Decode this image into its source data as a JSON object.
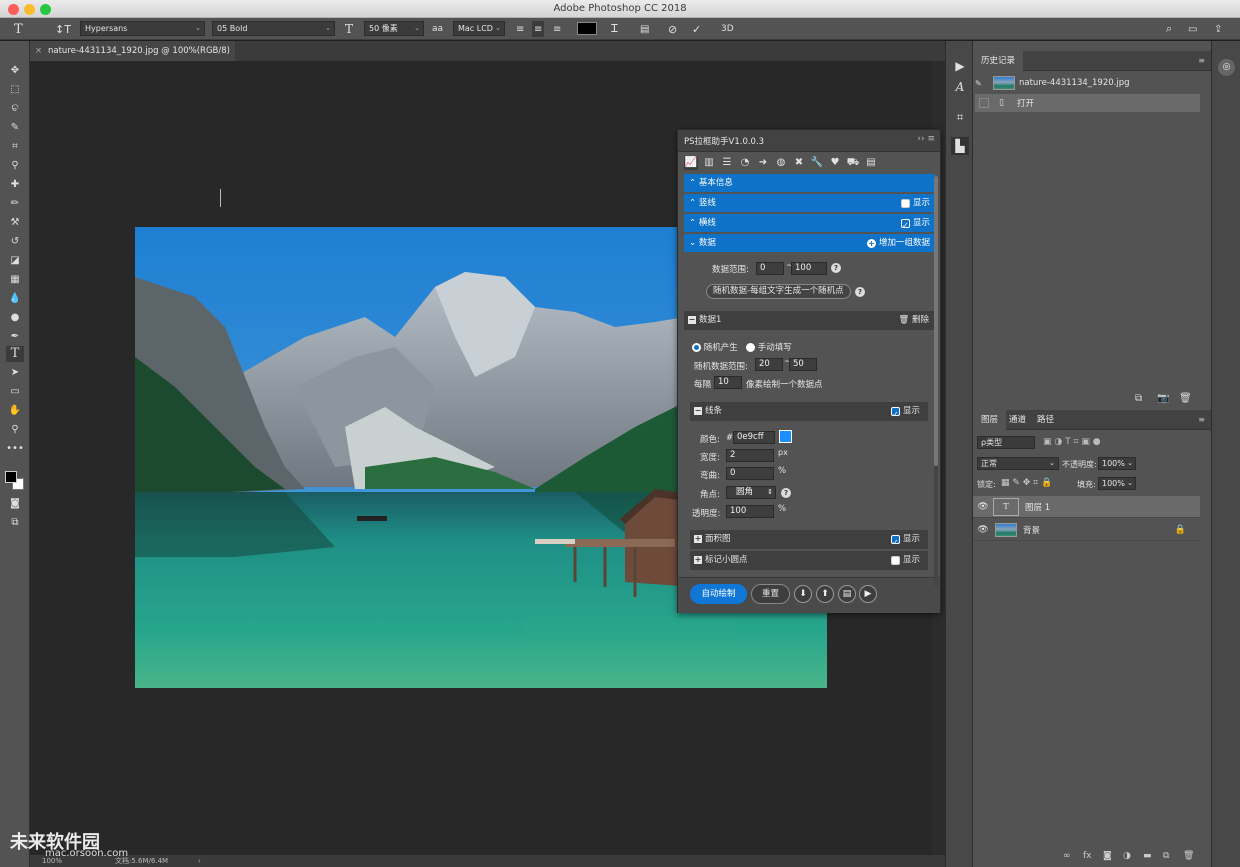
{
  "window": {
    "title": "Adobe Photoshop CC 2018"
  },
  "options_bar": {
    "font_family": "Hypersans",
    "font_style": "05 Bold",
    "font_size": "50 像素",
    "antialias": "Mac LCD",
    "aa_label": "aa",
    "three_d": "3D"
  },
  "document": {
    "tab": "nature-4431134_1920.jpg @ 100%(RGB/8)"
  },
  "status": {
    "zoom": "100%",
    "doc_size": "文档:5.6M/6.4M"
  },
  "plugin": {
    "title": "PS拉框助手V1.0.0.3",
    "sections": {
      "basic": "基本信息",
      "vline": "竖线",
      "hline": "横线",
      "data": "数据",
      "show": "显示",
      "add_group": "增加一组数据"
    },
    "data_range_label": "数据范围:",
    "data_range_min": "0",
    "data_range_max": "100",
    "random_btn": "随机数据-每组文字生成一个随机点",
    "group": {
      "title": "数据1",
      "delete": "删除"
    },
    "mode_random": "随机产生",
    "mode_manual": "手动填写",
    "random_range_label": "随机数据范围:",
    "random_min": "20",
    "random_max": "50",
    "every_label": "每隔",
    "every_value": "10",
    "every_suffix": "像素绘制一个数据点",
    "line": {
      "title": "线条",
      "show": "显示",
      "color_label": "颜色:",
      "color_hash": "#",
      "color_value": "0e9cff",
      "color_swatch": "#1a8fff",
      "width_label": "宽度:",
      "width_value": "2",
      "width_unit": "px",
      "curve_label": "弯曲:",
      "curve_value": "0",
      "curve_unit": "%",
      "corner_label": "角点:",
      "corner_value": "圆角",
      "opacity_label": "透明度:",
      "opacity_value": "100",
      "opacity_unit": "%"
    },
    "area": {
      "title": "面积图",
      "show": "显示"
    },
    "dots": {
      "title": "标记小圆点",
      "show": "显示"
    },
    "auto_draw": "自动绘制",
    "reset": "重置"
  },
  "history": {
    "title": "历史记录",
    "snapshot": "nature-4431134_1920.jpg",
    "step": "打开"
  },
  "layers": {
    "tabs": [
      "图层",
      "通道",
      "路径"
    ],
    "filter_placeholder": "ρ类型",
    "blend_mode": "正常",
    "opacity_label": "不透明度:",
    "opacity_value": "100%",
    "lock_label": "锁定:",
    "fill_label": "填充:",
    "fill_value": "100%",
    "items": [
      {
        "name": "图层 1",
        "kind": "text"
      },
      {
        "name": "背景",
        "kind": "image"
      }
    ]
  },
  "watermark": {
    "brand": "未来软件园",
    "url": "mac.orsoon.com"
  }
}
